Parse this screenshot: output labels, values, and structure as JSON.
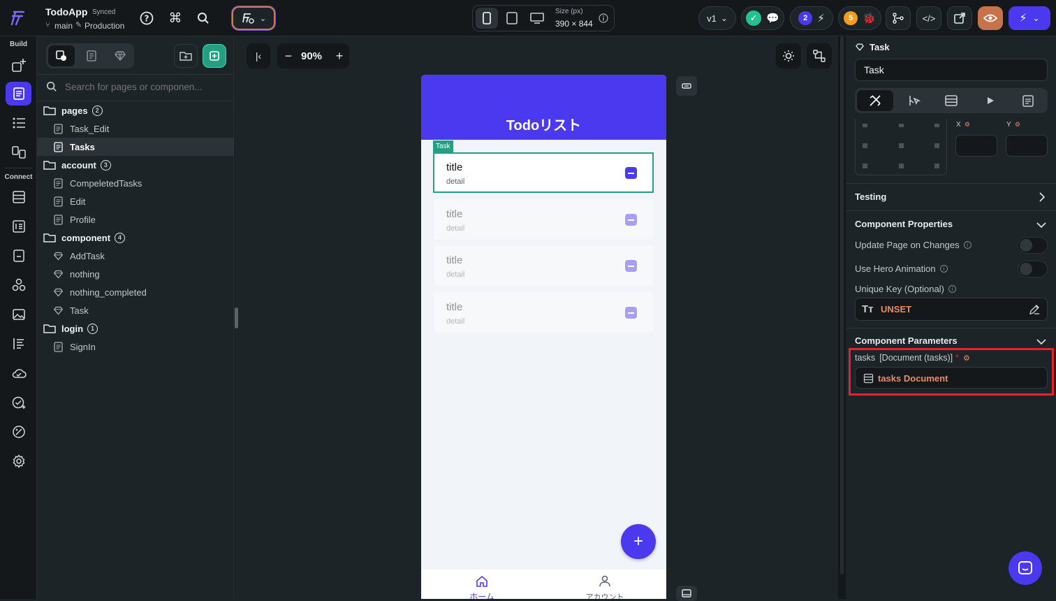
{
  "header": {
    "app_name": "TodoApp",
    "sync_status": "Synced",
    "branch": "main",
    "environment": "Production",
    "size_label": "Size (px)",
    "size_value": "390 × 844",
    "version": "v1",
    "notif_count_blue": "2",
    "notif_count_orange": "5"
  },
  "rail": {
    "build_label": "Build",
    "connect_label": "Connect"
  },
  "nav": {
    "search_placeholder": "Search for pages or componen...",
    "tree": [
      {
        "label": "pages",
        "count": "2",
        "type": "folder"
      },
      {
        "label": "Task_Edit",
        "type": "page"
      },
      {
        "label": "Tasks",
        "type": "page",
        "selected": true
      },
      {
        "label": "account",
        "count": "3",
        "type": "folder"
      },
      {
        "label": "CompeletedTasks",
        "type": "page"
      },
      {
        "label": "Edit",
        "type": "page"
      },
      {
        "label": "Profile",
        "type": "page"
      },
      {
        "label": "component",
        "count": "4",
        "type": "folder"
      },
      {
        "label": "AddTask",
        "type": "component"
      },
      {
        "label": "nothing",
        "type": "component"
      },
      {
        "label": "nothing_completed",
        "type": "component"
      },
      {
        "label": "Task",
        "type": "component"
      },
      {
        "label": "login",
        "count": "1",
        "type": "folder"
      },
      {
        "label": "SignIn",
        "type": "page"
      }
    ]
  },
  "canvas": {
    "zoom": "90%",
    "phone": {
      "appbar_title": "Todoリスト",
      "selected_tag": "Task",
      "cards": [
        {
          "title": "title",
          "detail": "detail"
        },
        {
          "title": "title",
          "detail": "detail"
        },
        {
          "title": "title",
          "detail": "detail"
        },
        {
          "title": "title",
          "detail": "detail"
        }
      ],
      "fab_label": "+",
      "bottom_nav": [
        {
          "label": "ホーム"
        },
        {
          "label": "アカウント"
        }
      ]
    }
  },
  "props": {
    "widget_type": "Task",
    "widget_name": "Task",
    "axis_x": "X",
    "axis_y": "Y",
    "testing_label": "Testing",
    "component_properties_label": "Component Properties",
    "update_page_label": "Update Page on Changes",
    "hero_label": "Use Hero Animation",
    "unique_key_label": "Unique Key (Optional)",
    "unique_key_value": "UNSET",
    "component_parameters_label": "Component Parameters",
    "param_name": "tasks",
    "param_type": "[Document (tasks)]",
    "param_required": "*",
    "param_value": "tasks Document"
  },
  "colors": {
    "primary": "#4b39ef",
    "accent": "#ee8b60",
    "success": "#24c28f",
    "highlight": "#e3242b"
  }
}
